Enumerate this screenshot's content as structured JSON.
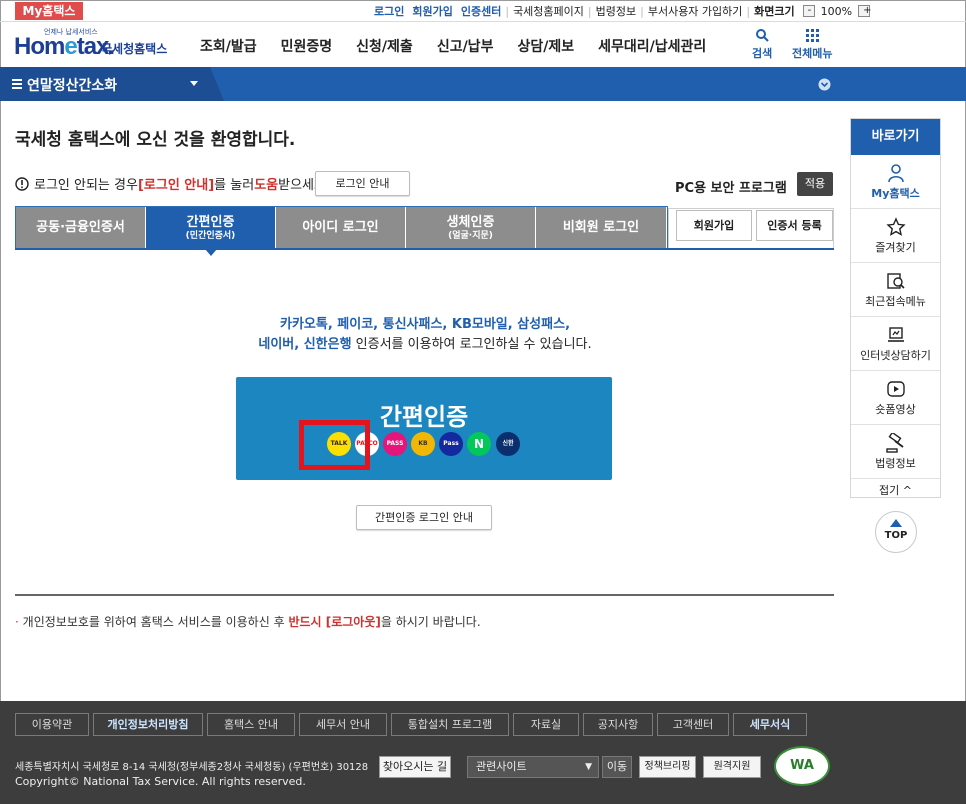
{
  "top": {
    "my_home": "My홈택스",
    "links": [
      "로그인",
      "회원가입",
      "인증센터",
      "국세청홈페이지",
      "법령정보",
      "부서사용자 가입하기"
    ],
    "screen_size_label": "화면크기",
    "zoom_minus": "-",
    "zoom_level": "100%",
    "zoom_plus": "+"
  },
  "header": {
    "logo_sub": "언제나 납세서비스",
    "logo_main_a": "Hom",
    "logo_main_b": "e",
    "logo_main_c": "tax.",
    "logo_kr": "국세청홈택스",
    "gnb": [
      "조회/발급",
      "민원증명",
      "신청/제출",
      "신고/납부",
      "상담/제보",
      "세무대리/납세관리"
    ],
    "search_label": "검색",
    "allmenu_label": "전체메뉴"
  },
  "bar": {
    "title": "연말정산간소화"
  },
  "main": {
    "welcome": "국세청 홈택스에 오신 것을 환영합니다.",
    "help_a": "로그인 안되는 경우 ",
    "help_b": "[로그인 안내]",
    "help_c": "를 눌러 ",
    "help_d": "도움",
    "help_e": "받으세요.",
    "login_guide_btn": "로그인 안내",
    "pc_security": "PC용 보안 프로그램",
    "apply_btn": "적용",
    "tabs": [
      {
        "label": "공동·금융인증서",
        "sub": ""
      },
      {
        "label": "간편인증",
        "sub": "(민간인증서)"
      },
      {
        "label": "아이디 로그인",
        "sub": ""
      },
      {
        "label": "생체인증",
        "sub": "(얼굴·지문)"
      },
      {
        "label": "비회원 로그인",
        "sub": ""
      }
    ],
    "signup_btn": "회원가입",
    "cert_register_btn": "인증서 등록",
    "desc_line1": "카카오톡, 페이코, 통신사패스, KB모바일, 삼성패스,",
    "desc_line2_blue": "네이버, 신한은행",
    "desc_line2_rest": " 인증서를 이용하여 로그인하실 수 있습니다.",
    "simple_auth_title": "간편인증",
    "providers": [
      "TALK",
      "PAYCO",
      "PASS",
      "KB",
      "Pass",
      "N",
      "신한"
    ],
    "simple_guide_btn": "간편인증 로그인 안내",
    "notice_a": "개인정보보호를 위하여 홈택스 서비스를 이용하신 후 ",
    "notice_b": "반드시 [로그아웃]",
    "notice_c": "을 하시기 바랍니다."
  },
  "quick": {
    "title": "바로가기",
    "items": [
      "My홈택스",
      "즐겨찾기",
      "최근접속메뉴",
      "인터넷상담하기",
      "숏폼영상",
      "법령정보"
    ],
    "fold": "접기 ^",
    "top": "TOP"
  },
  "footer": {
    "nav": [
      "이용약관",
      "개인정보처리방침",
      "홈택스 안내",
      "세무서 안내",
      "통합설치 프로그램",
      "자료실",
      "공지사항",
      "고객센터",
      "세무서식"
    ],
    "address": "세종특별자치시 국세청로 8-14 국세청(정부세종2청사 국세청동) (우편번호) 30128",
    "directions_btn": "찾아오시는 길",
    "related_sites": "관련사이트",
    "go_btn": "이동",
    "policy_btn": "정책브리핑",
    "remote_btn": "원격지원",
    "wa_mark": "WA",
    "copyright": "Copyright© National Tax Service. All rights reserved."
  },
  "colors": {
    "primary": "#1f5fae",
    "accent_red": "#e4141c",
    "tab_gray": "#8d8d8d",
    "footer_bg": "#3d3d3d"
  }
}
